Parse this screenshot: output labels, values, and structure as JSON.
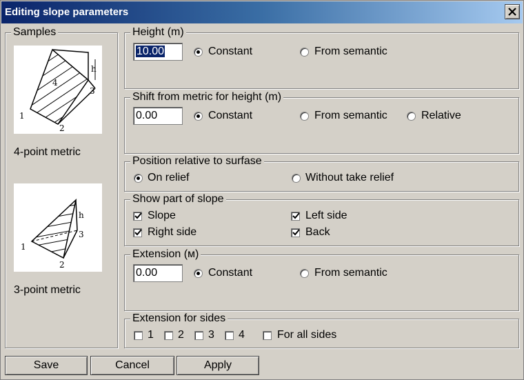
{
  "window": {
    "title": "Editing slope parameters",
    "close_label": "✕"
  },
  "samples": {
    "legend": "Samples",
    "metric4": {
      "caption": "4-point metric",
      "h": "h",
      "labels": [
        "1",
        "2",
        "3",
        "4"
      ]
    },
    "metric3": {
      "caption": "3-point metric",
      "h": "h",
      "labels": [
        "1",
        "2",
        "3"
      ]
    }
  },
  "height": {
    "legend": "Height (m)",
    "value": "10.00",
    "options": [
      "Constant",
      "From semantic"
    ],
    "selected": "Constant"
  },
  "shift": {
    "legend": "Shift from metric for height (m)",
    "value": "0.00",
    "options": [
      "Constant",
      "From semantic",
      "Relative"
    ],
    "selected": "Constant"
  },
  "position": {
    "legend": "Position relative to surfase",
    "options": [
      "On relief",
      "Without take relief"
    ],
    "selected": "On relief"
  },
  "show_part": {
    "legend": "Show part of slope",
    "items": [
      {
        "label": "Slope",
        "checked": true
      },
      {
        "label": "Right side",
        "checked": true
      },
      {
        "label": "Left side",
        "checked": true
      },
      {
        "label": "Back",
        "checked": true
      }
    ]
  },
  "extension": {
    "legend": "Extension (м)",
    "value": "0.00",
    "options": [
      "Constant",
      "From semantic"
    ],
    "selected": "Constant"
  },
  "extension_sides": {
    "legend": "Extension for sides",
    "items": [
      {
        "label": "1",
        "checked": false
      },
      {
        "label": "2",
        "checked": false
      },
      {
        "label": "3",
        "checked": false
      },
      {
        "label": "4",
        "checked": false
      },
      {
        "label": "For all sides",
        "checked": false
      }
    ]
  },
  "buttons": {
    "save": "Save",
    "cancel": "Cancel",
    "apply": "Apply"
  }
}
